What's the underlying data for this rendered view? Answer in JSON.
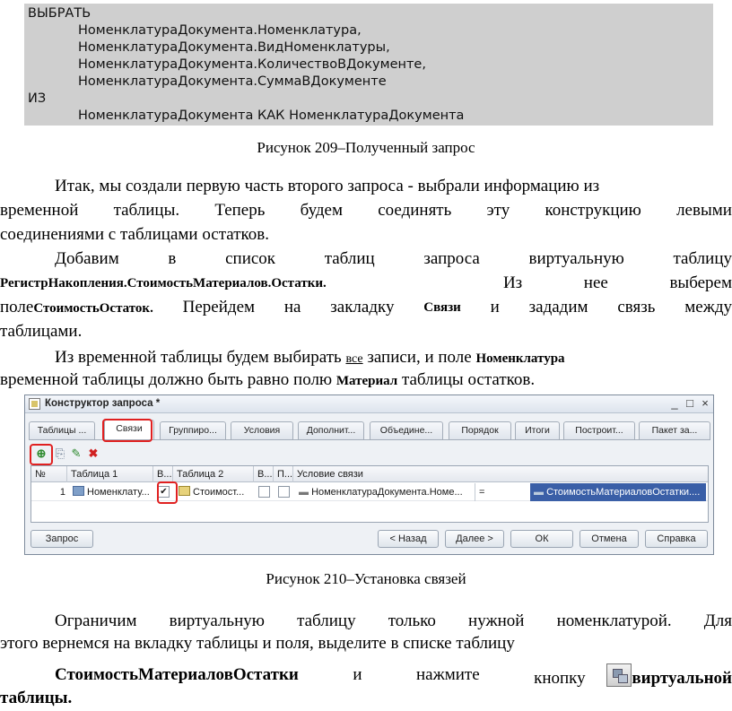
{
  "code": {
    "lines": [
      "ВЫБРАТЬ",
      "НоменклатураДокумента.Номенклатура,",
      "НоменклатураДокумента.ВидНоменклатуры,",
      "НоменклатураДокумента.КоличествоВДокументе,",
      "НоменклатураДокумента.СуммаВДокументе",
      "ИЗ",
      "НоменклатураДокумента КАК НоменклатураДокумента"
    ]
  },
  "caption1": "Рисунок 209–Полученный запрос",
  "para1": {
    "l1": "Итак, мы создали первую часть второго запроса - выбрали информацию из",
    "l2": [
      "временной",
      "таблицы.",
      "Теперь",
      "будем",
      "соединять",
      "эту",
      "конструкцию",
      "левыми"
    ],
    "l3": "соединениями с таблицами остатков."
  },
  "para2": {
    "l1": [
      "Добавим",
      "в",
      "список",
      "таблиц",
      "запроса",
      "виртуальную",
      "таблицу"
    ],
    "l2_bold": "РегистрНакопления.СтоимостьМатериалов.Остатки.",
    "l2_rest": [
      "Из",
      "нее",
      "выберем"
    ],
    "l3_a": "поле",
    "l3_bold": "СтоимостьОстаток.",
    "l3_b": [
      "Перейдем",
      "на",
      "закладку"
    ],
    "l3_bold2": "Связи",
    "l3_c": [
      "и",
      "зададим",
      "связь",
      "между"
    ],
    "l4": "таблицами."
  },
  "para3": {
    "l1_a": "Из временной таблицы будем выбирать",
    "l1_u": "все",
    "l1_b": "записи, и поле",
    "l1_bold": "Номенклатура",
    "l2_a": "временной таблицы должно быть равно полю",
    "l2_bold": "Материал",
    "l2_b": "таблицы остатков."
  },
  "dialog": {
    "title": "Конструктор запроса *",
    "window_buttons": [
      "_",
      "□",
      "×"
    ],
    "tabs": [
      "Таблицы ...",
      "Связи",
      "Группиро...",
      "Условия",
      "Дополнит...",
      "Объедине...",
      "Порядок",
      "Итоги",
      "Построит...",
      "Пакет за..."
    ],
    "toolbar_icons": [
      "add-icon",
      "copy-icon",
      "edit-icon",
      "delete-icon"
    ],
    "grid": {
      "headers": [
        "№",
        "Таблица 1",
        "В...",
        "Таблица 2",
        "В...",
        "П...",
        "Условие связи"
      ],
      "row": {
        "num": "1",
        "table1": "Номенклату...",
        "all1_checked": true,
        "table2": "Стоимост...",
        "all2_checked": false,
        "arbitrary_checked": false,
        "field1": "НоменклатураДокумента.Номе...",
        "op": "=",
        "field2": "СтоимостьМатериаловОстатки...."
      }
    },
    "footer_buttons": {
      "query": "Запрос",
      "back": "< Назад",
      "next": "Далее >",
      "ok": "ОК",
      "cancel": "Отмена",
      "help": "Справка"
    }
  },
  "caption2": "Рисунок 210–Установка связей",
  "para4": {
    "l1": [
      "Ограничим",
      "виртуальную",
      "таблицу",
      "только",
      "нужной",
      "номенклатурой.",
      "Для"
    ],
    "l2": "этого вернемся на вкладку таблицы и поля, выделите в списке таблицу",
    "l3_bold": "СтоимостьМатериаловОстатки",
    "l3_mid": [
      "и",
      "нажмите",
      "кнопку"
    ],
    "l3_bold2": "виртуальной",
    "l4_bold": "таблицы."
  },
  "colors": {
    "code_bg": "#cfcfcf",
    "highlight_red": "#e02020",
    "selection_blue": "#3a5fa7"
  }
}
